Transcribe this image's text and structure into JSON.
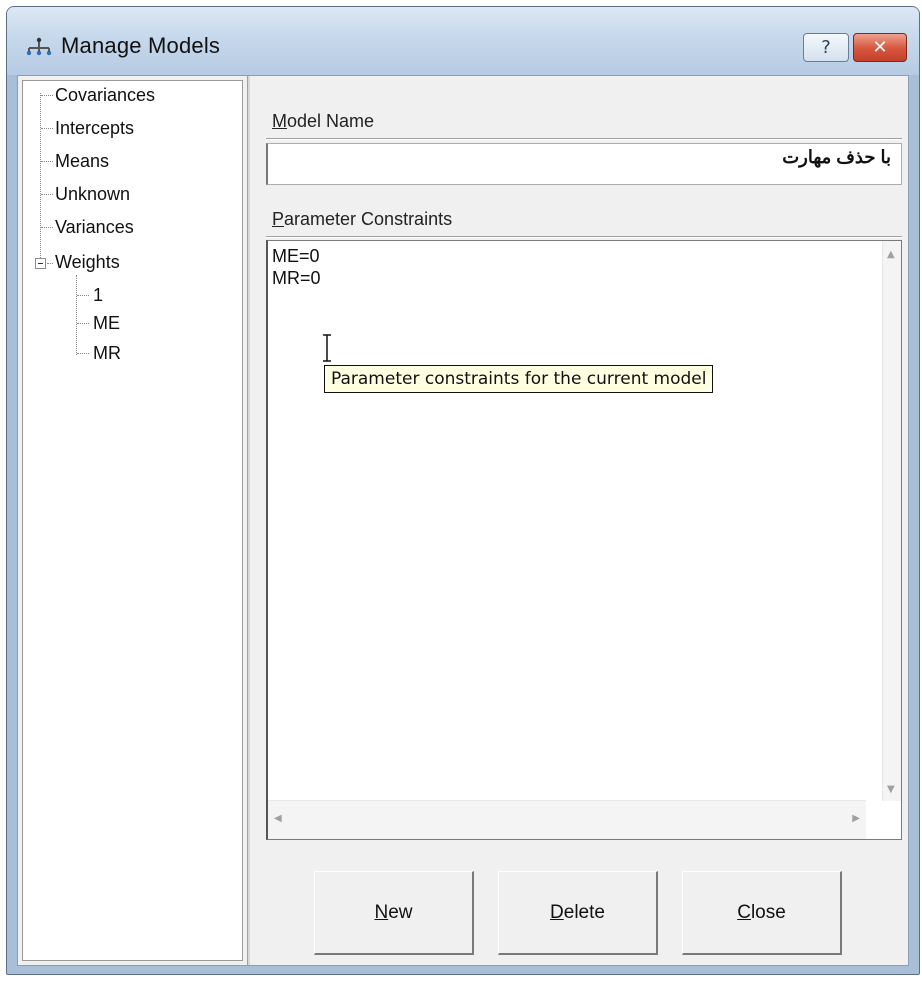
{
  "window": {
    "title": "Manage Models",
    "help_glyph": "?",
    "close_glyph": "✕"
  },
  "tree": {
    "items": [
      {
        "label": "Covariances"
      },
      {
        "label": "Intercepts"
      },
      {
        "label": "Means"
      },
      {
        "label": "Unknown"
      },
      {
        "label": "Variances"
      },
      {
        "label": "Weights",
        "expanded": true,
        "children": [
          {
            "label": "1"
          },
          {
            "label": "ME"
          },
          {
            "label": "MR"
          }
        ]
      }
    ]
  },
  "model_name": {
    "label_first": "M",
    "label_rest": "odel Name",
    "value": "با حذف مهارت"
  },
  "parameter_constraints": {
    "label_first": "P",
    "label_rest": "arameter Constraints",
    "text": "ME=0\nMR=0"
  },
  "tooltip": {
    "text": "Parameter constraints for the current model"
  },
  "buttons": {
    "new": {
      "mnemonic": "N",
      "rest": "ew"
    },
    "delete": {
      "mnemonic": "D",
      "rest": "elete"
    },
    "close": {
      "mnemonic": "C",
      "rest": "lose"
    }
  },
  "icons": {
    "app": "model-tree-icon",
    "help": "question-icon",
    "close": "close-icon"
  }
}
